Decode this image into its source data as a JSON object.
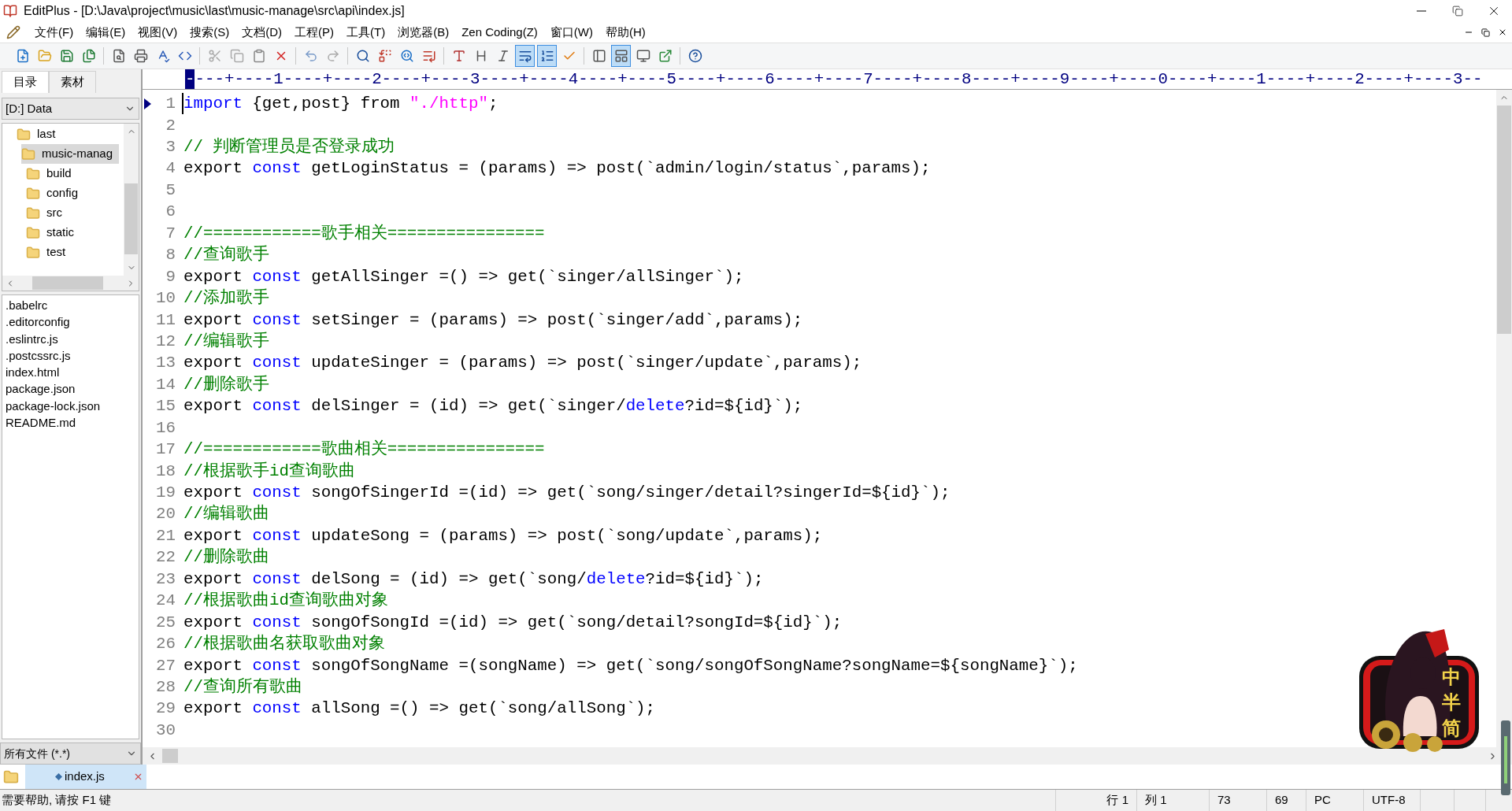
{
  "window": {
    "title": "EditPlus - [D:\\Java\\project\\music\\last\\music-manage\\src\\api\\index.js]"
  },
  "menu": [
    "文件(F)",
    "编辑(E)",
    "视图(V)",
    "搜索(S)",
    "文档(D)",
    "工程(P)",
    "工具(T)",
    "浏览器(B)",
    "Zen Coding(Z)",
    "窗口(W)",
    "帮助(H)"
  ],
  "toolbar": [
    {
      "kind": "new",
      "selected": false
    },
    {
      "kind": "open",
      "selected": false
    },
    {
      "kind": "save",
      "selected": false
    },
    {
      "kind": "save-all",
      "selected": false
    },
    {
      "kind": "sep"
    },
    {
      "kind": "preview",
      "selected": false
    },
    {
      "kind": "print",
      "selected": false
    },
    {
      "kind": "spell",
      "selected": false
    },
    {
      "kind": "browser",
      "selected": false
    },
    {
      "kind": "sep"
    },
    {
      "kind": "cut",
      "selected": false
    },
    {
      "kind": "copy",
      "selected": false
    },
    {
      "kind": "paste",
      "selected": false
    },
    {
      "kind": "delete",
      "selected": false
    },
    {
      "kind": "sep"
    },
    {
      "kind": "undo",
      "selected": false
    },
    {
      "kind": "redo",
      "selected": false
    },
    {
      "kind": "sep"
    },
    {
      "kind": "find",
      "selected": false
    },
    {
      "kind": "replace",
      "selected": false
    },
    {
      "kind": "find-files",
      "selected": false
    },
    {
      "kind": "goto",
      "selected": false
    },
    {
      "kind": "sep"
    },
    {
      "kind": "font",
      "selected": false
    },
    {
      "kind": "heading",
      "selected": false
    },
    {
      "kind": "italic",
      "selected": false
    },
    {
      "kind": "wrap",
      "selected": true
    },
    {
      "kind": "line-numbers",
      "selected": true
    },
    {
      "kind": "check",
      "selected": false
    },
    {
      "kind": "sep"
    },
    {
      "kind": "panel",
      "selected": false
    },
    {
      "kind": "layout",
      "selected": true
    },
    {
      "kind": "monitor",
      "selected": false
    },
    {
      "kind": "external",
      "selected": false
    },
    {
      "kind": "sep"
    },
    {
      "kind": "help",
      "selected": false
    }
  ],
  "sidebar": {
    "tabs": [
      {
        "label": "目录",
        "selected": true
      },
      {
        "label": "素材",
        "selected": false
      }
    ],
    "drive": "[D:] Data",
    "tree": [
      {
        "label": "last",
        "selected": false,
        "children": [
          {
            "label": "music-manag",
            "selected": true,
            "children": [
              {
                "label": "build",
                "selected": false
              },
              {
                "label": "config",
                "selected": false
              },
              {
                "label": "src",
                "selected": false
              },
              {
                "label": "static",
                "selected": false
              },
              {
                "label": "test",
                "selected": false
              }
            ]
          }
        ]
      }
    ],
    "files": [
      ".babelrc",
      ".editorconfig",
      ".eslintrc.js",
      ".postcssrc.js",
      "index.html",
      "package.json",
      "package-lock.json",
      "README.md"
    ],
    "filter": "所有文件 (*.*)"
  },
  "editor": {
    "ruler_start": "-",
    "ruler": "---+----1----+----2----+----3----+----4----+----5----+----6----+----7----+----8----+----9----+----0----+----1----+----2----+----3--",
    "lines": [
      {
        "n": "1",
        "current": true,
        "tokens": [
          {
            "kind": "keyword",
            "text": "import"
          },
          {
            "kind": "plain",
            "text": " {get,post} from "
          },
          {
            "kind": "string",
            "text": "\"./http\""
          },
          {
            "kind": "plain",
            "text": ";"
          }
        ]
      },
      {
        "n": "2",
        "current": false
      },
      {
        "n": "3",
        "current": false,
        "tokens": [
          {
            "kind": "comment",
            "text": "// 判断管理员是否登录成功"
          }
        ]
      },
      {
        "n": "4",
        "current": false,
        "tokens": [
          {
            "kind": "plain",
            "text": "export "
          },
          {
            "kind": "keyword",
            "text": "const"
          },
          {
            "kind": "plain",
            "text": " getLoginStatus = (params) => post(`admin/login/status`,params);"
          }
        ]
      },
      {
        "n": "5",
        "current": false
      },
      {
        "n": "6",
        "current": false
      },
      {
        "n": "7",
        "current": false,
        "tokens": [
          {
            "kind": "comment",
            "text": "//============歌手相关================"
          }
        ]
      },
      {
        "n": "8",
        "current": false,
        "tokens": [
          {
            "kind": "comment",
            "text": "//查询歌手"
          }
        ]
      },
      {
        "n": "9",
        "current": false,
        "tokens": [
          {
            "kind": "plain",
            "text": "export "
          },
          {
            "kind": "keyword",
            "text": "const"
          },
          {
            "kind": "plain",
            "text": " getAllSinger =() => get(`singer/allSinger`);"
          }
        ]
      },
      {
        "n": "10",
        "current": false,
        "tokens": [
          {
            "kind": "comment",
            "text": "//添加歌手"
          }
        ]
      },
      {
        "n": "11",
        "current": false,
        "tokens": [
          {
            "kind": "plain",
            "text": "export "
          },
          {
            "kind": "keyword",
            "text": "const"
          },
          {
            "kind": "plain",
            "text": " setSinger = (params) => post(`singer/add`,params);"
          }
        ]
      },
      {
        "n": "12",
        "current": false,
        "tokens": [
          {
            "kind": "comment",
            "text": "//编辑歌手"
          }
        ]
      },
      {
        "n": "13",
        "current": false,
        "tokens": [
          {
            "kind": "plain",
            "text": "export "
          },
          {
            "kind": "keyword",
            "text": "const"
          },
          {
            "kind": "plain",
            "text": " updateSinger = (params) => post(`singer/update`,params);"
          }
        ]
      },
      {
        "n": "14",
        "current": false,
        "tokens": [
          {
            "kind": "comment",
            "text": "//删除歌手"
          }
        ]
      },
      {
        "n": "15",
        "current": false,
        "tokens": [
          {
            "kind": "plain",
            "text": "export "
          },
          {
            "kind": "keyword",
            "text": "const"
          },
          {
            "kind": "plain",
            "text": " delSinger = (id) => get(`singer/"
          },
          {
            "kind": "keyword",
            "text": "delete"
          },
          {
            "kind": "plain",
            "text": "?id=${id}`);"
          }
        ]
      },
      {
        "n": "16",
        "current": false
      },
      {
        "n": "17",
        "current": false,
        "tokens": [
          {
            "kind": "comment",
            "text": "//============歌曲相关================"
          }
        ]
      },
      {
        "n": "18",
        "current": false,
        "tokens": [
          {
            "kind": "comment",
            "text": "//根据歌手id查询歌曲"
          }
        ]
      },
      {
        "n": "19",
        "current": false,
        "tokens": [
          {
            "kind": "plain",
            "text": "export "
          },
          {
            "kind": "keyword",
            "text": "const"
          },
          {
            "kind": "plain",
            "text": " songOfSingerId =(id) => get(`song/singer/detail?singerId=${id}`);"
          }
        ]
      },
      {
        "n": "20",
        "current": false,
        "tokens": [
          {
            "kind": "comment",
            "text": "//编辑歌曲"
          }
        ]
      },
      {
        "n": "21",
        "current": false,
        "tokens": [
          {
            "kind": "plain",
            "text": "export "
          },
          {
            "kind": "keyword",
            "text": "const"
          },
          {
            "kind": "plain",
            "text": " updateSong = (params) => post(`song/update`,params);"
          }
        ]
      },
      {
        "n": "22",
        "current": false,
        "tokens": [
          {
            "kind": "comment",
            "text": "//删除歌曲"
          }
        ]
      },
      {
        "n": "23",
        "current": false,
        "tokens": [
          {
            "kind": "plain",
            "text": "export "
          },
          {
            "kind": "keyword",
            "text": "const"
          },
          {
            "kind": "plain",
            "text": " delSong = (id) => get(`song/"
          },
          {
            "kind": "keyword",
            "text": "delete"
          },
          {
            "kind": "plain",
            "text": "?id=${id}`);"
          }
        ]
      },
      {
        "n": "24",
        "current": false,
        "tokens": [
          {
            "kind": "comment",
            "text": "//根据歌曲id查询歌曲对象"
          }
        ]
      },
      {
        "n": "25",
        "current": false,
        "tokens": [
          {
            "kind": "plain",
            "text": "export "
          },
          {
            "kind": "keyword",
            "text": "const"
          },
          {
            "kind": "plain",
            "text": " songOfSongId =(id) => get(`song/detail?songId=${id}`);"
          }
        ]
      },
      {
        "n": "26",
        "current": false,
        "tokens": [
          {
            "kind": "comment",
            "text": "//根据歌曲名获取歌曲对象"
          }
        ]
      },
      {
        "n": "27",
        "current": false,
        "tokens": [
          {
            "kind": "plain",
            "text": "export "
          },
          {
            "kind": "keyword",
            "text": "const"
          },
          {
            "kind": "plain",
            "text": " songOfSongName =(songName) => get(`song/songOfSongName?songName=${songName}`);"
          }
        ]
      },
      {
        "n": "28",
        "current": false,
        "tokens": [
          {
            "kind": "comment",
            "text": "//查询所有歌曲"
          }
        ]
      },
      {
        "n": "29",
        "current": false,
        "tokens": [
          {
            "kind": "plain",
            "text": "export "
          },
          {
            "kind": "keyword",
            "text": "const"
          },
          {
            "kind": "plain",
            "text": " allSong =() => get(`song/allSong`);"
          }
        ]
      },
      {
        "n": "30",
        "current": false
      }
    ]
  },
  "document_tabs": [
    {
      "label": "index.js",
      "selected": true
    }
  ],
  "ime_badge": {
    "labels": [
      "中",
      "半",
      "简"
    ]
  },
  "status_bar": {
    "message": "需要帮助, 请按 F1 键",
    "cells": [
      "行 1",
      "列 1",
      "73",
      "69",
      "PC",
      "UTF-8"
    ]
  }
}
